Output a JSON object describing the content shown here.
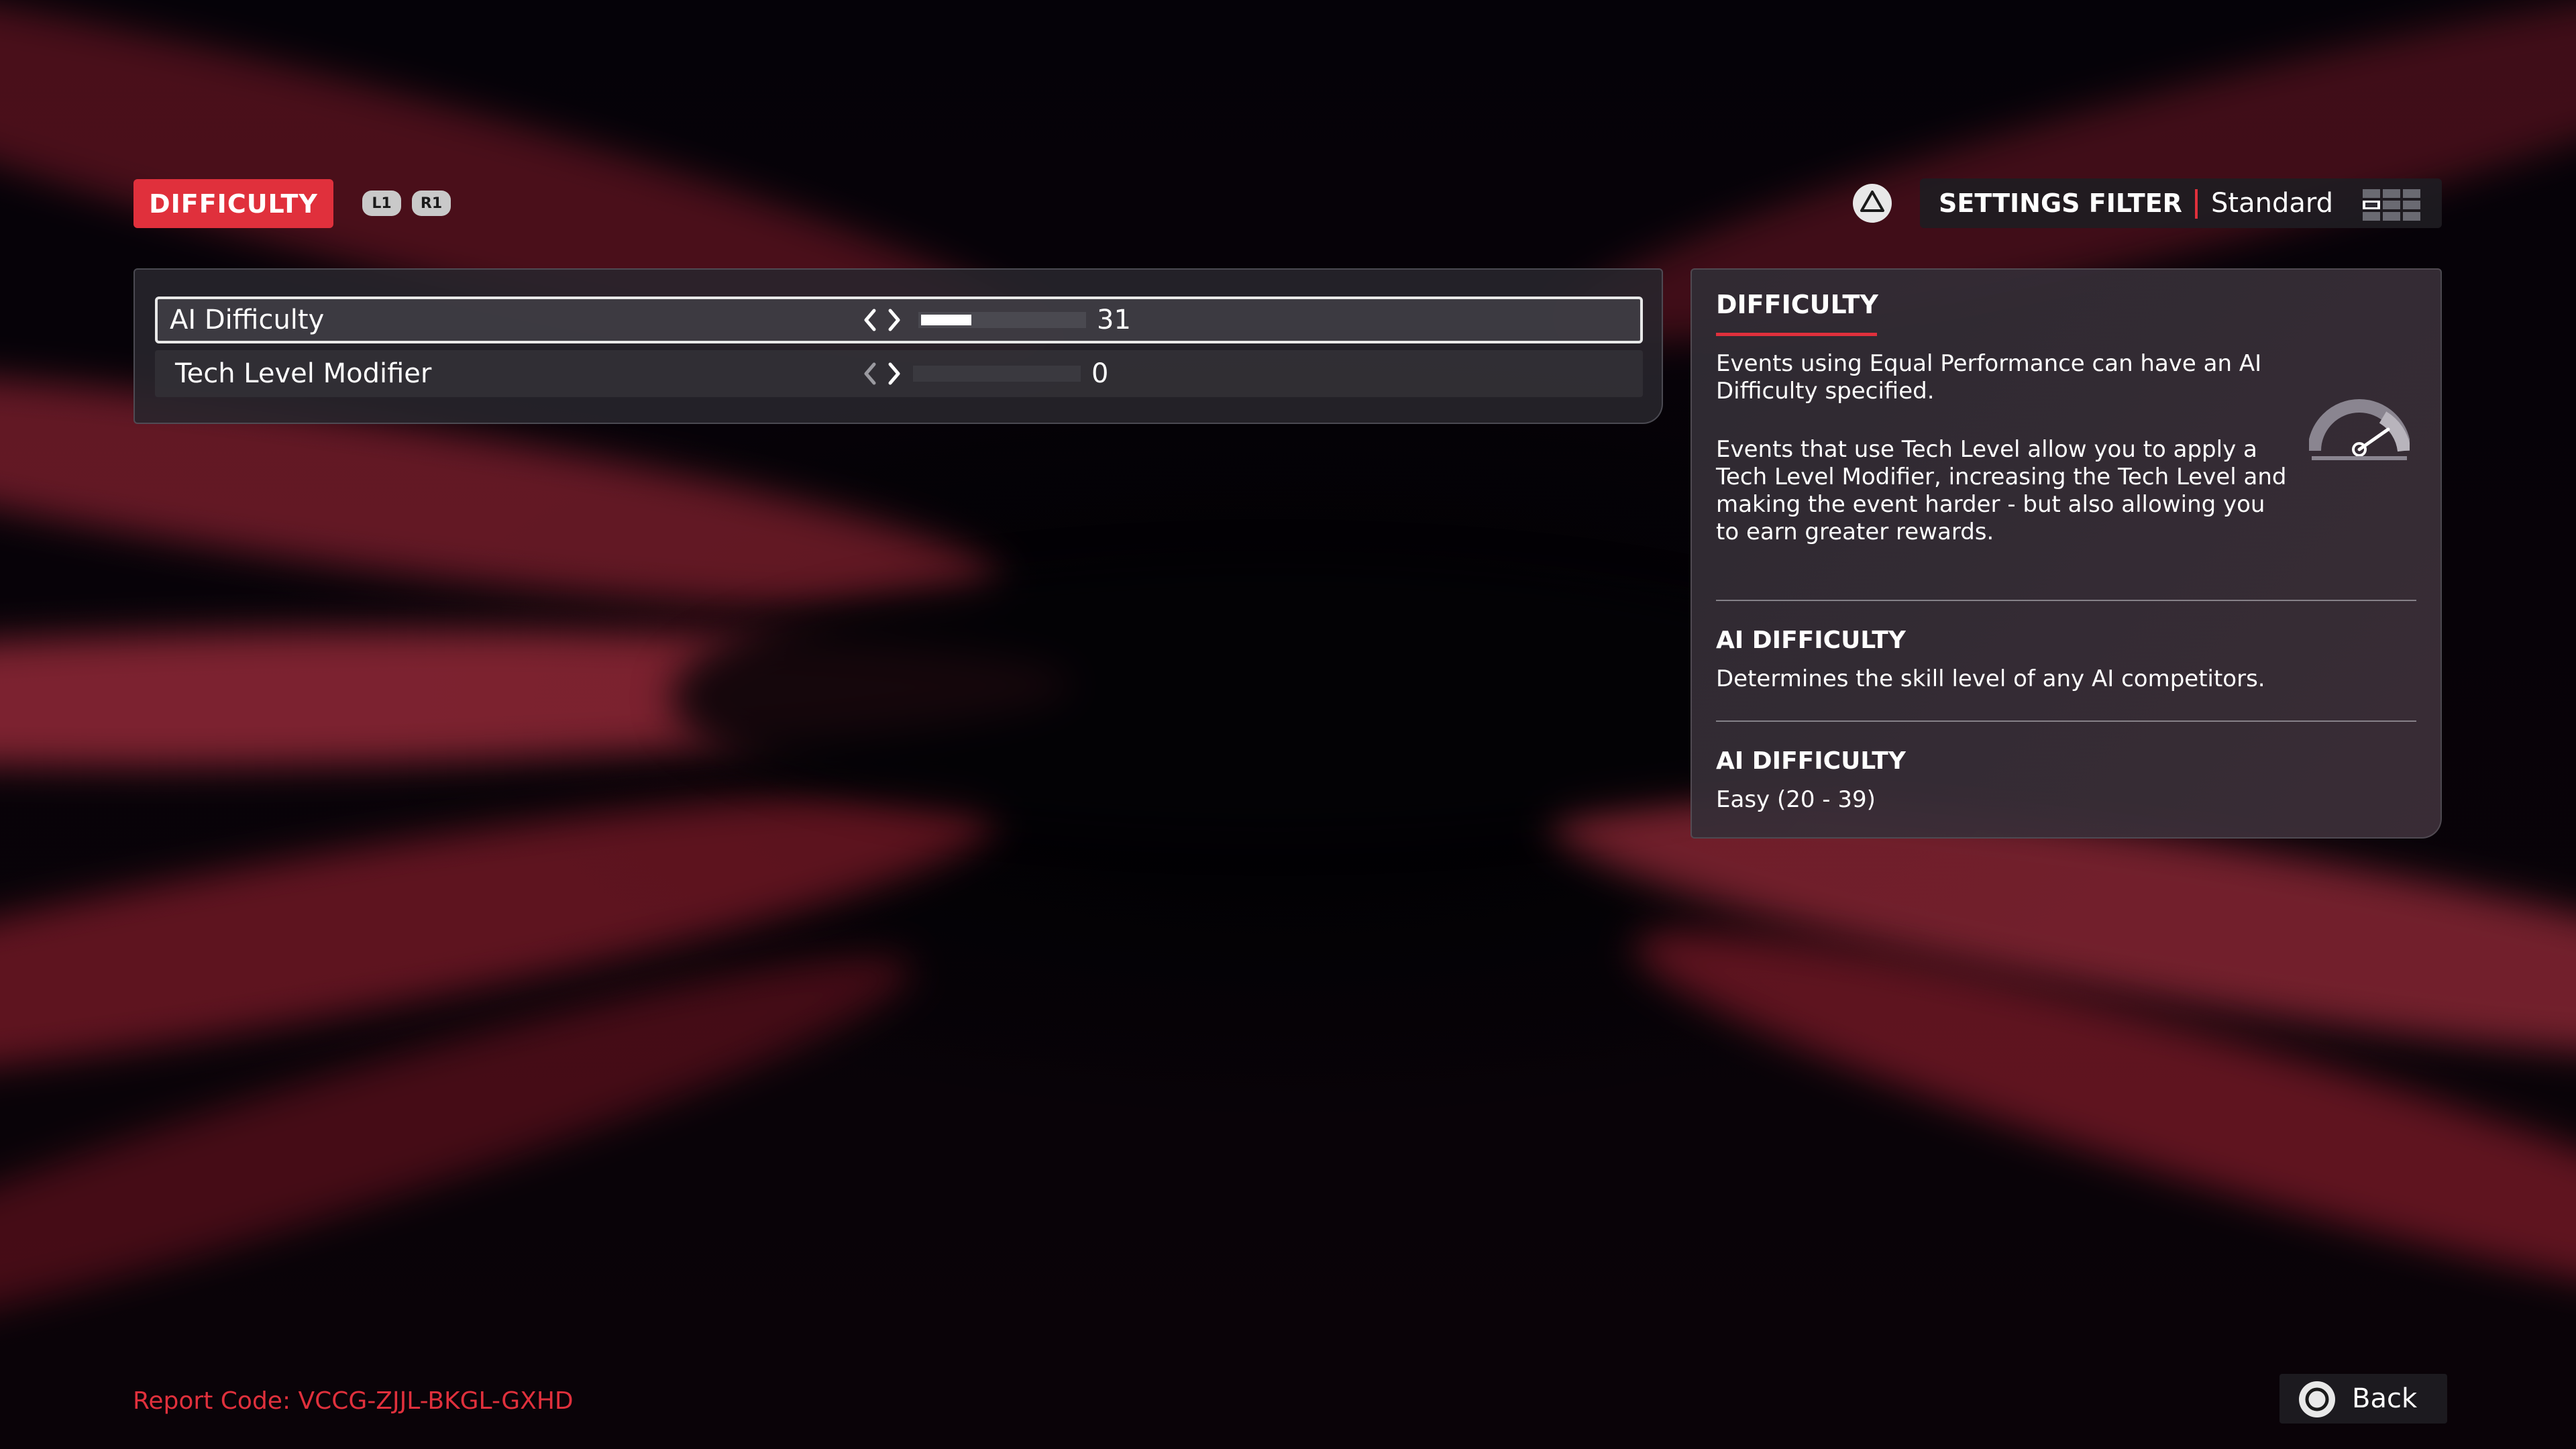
{
  "header": {
    "tab_label": "DIFFICULTY",
    "l1_label": "L1",
    "r1_label": "R1",
    "triangle_icon": "triangle-icon",
    "settings_filter_label": "SETTINGS FILTER",
    "settings_filter_value": "Standard",
    "filter_icon": "grid-toggle-icon"
  },
  "settings": {
    "rows": [
      {
        "label": "AI Difficulty",
        "value": "31",
        "fill_fraction": 0.31,
        "selected": true
      },
      {
        "label": "Tech Level Modifier",
        "value": "0",
        "fill_fraction": 0.0,
        "selected": false
      }
    ]
  },
  "info_panel": {
    "title": "DIFFICULTY",
    "paragraph_1": "Events using Equal Performance can have an AI Difficulty specified.",
    "paragraph_2": "Events that use Tech Level allow you to apply a Tech Level Modifier, increasing the Tech Level and making the event harder - but also allowing you to earn greater rewards.",
    "icon": "speedometer-icon",
    "section_1_title": "AI DIFFICULTY",
    "section_1_text": "Determines the skill level of any AI competitors.",
    "section_2_title": "AI DIFFICULTY",
    "section_2_text": "Easy (20 - 39)"
  },
  "footer": {
    "report_code": "Report Code: VCCG-ZJJL-BKGL-GXHD",
    "back_label": "Back",
    "back_icon": "circle-button-icon"
  },
  "colors": {
    "accent": "#e0303c",
    "panel": "#2e2c34",
    "background": "#050208"
  }
}
